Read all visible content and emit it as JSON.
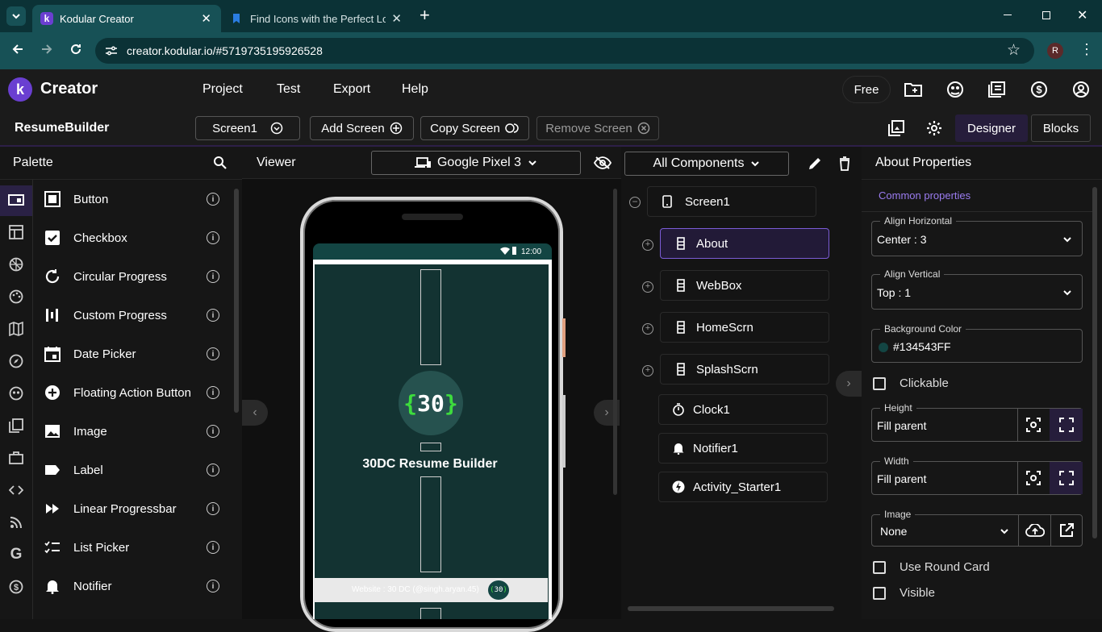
{
  "browser": {
    "tabs": [
      {
        "title": "Kodular Creator",
        "icon": "kodular-logo-icon"
      },
      {
        "title": "Find Icons with the Perfect Look",
        "icon": "bookmark-icon"
      }
    ],
    "url": "creator.kodular.io/#5719735195926528",
    "profile_initial": "R"
  },
  "app": {
    "logo_letter": "k",
    "name": "Creator",
    "menu": [
      "Project",
      "Test",
      "Export",
      "Help"
    ],
    "plan_badge": "Free"
  },
  "toolbar": {
    "project_name": "ResumeBuilder",
    "screen_select": "Screen1",
    "add_screen": "Add Screen",
    "copy_screen": "Copy Screen",
    "remove_screen": "Remove Screen",
    "designer": "Designer",
    "blocks": "Blocks"
  },
  "palette": {
    "title": "Palette",
    "items": [
      "Button",
      "Checkbox",
      "Circular Progress",
      "Custom Progress",
      "Date Picker",
      "Floating Action Button",
      "Image",
      "Label",
      "Linear Progressbar",
      "List Picker",
      "Notifier"
    ]
  },
  "viewer": {
    "title": "Viewer",
    "device": "Google Pixel 3",
    "status_time": "12:00",
    "logo_text": "30",
    "app_title": "30DC Resume Builder",
    "footer_text": "Website : 30 DC (@singh.aryan.45)",
    "footer_badge": "30"
  },
  "components": {
    "filter": "All Components",
    "root": "Screen1",
    "nodes": [
      "About",
      "WebBox",
      "HomeScrn",
      "SplashScrn",
      "Clock1",
      "Notifier1",
      "Activity_Starter1"
    ]
  },
  "properties": {
    "title": "About Properties",
    "section": "Common properties",
    "align_horizontal_label": "Align Horizontal",
    "align_horizontal": "Center : 3",
    "align_vertical_label": "Align Vertical",
    "align_vertical": "Top : 1",
    "background_color_label": "Background Color",
    "background_color": "#134543FF",
    "clickable": "Clickable",
    "height_label": "Height",
    "height": "Fill parent",
    "width_label": "Width",
    "width": "Fill parent",
    "image_label": "Image",
    "image": "None",
    "use_round_card": "Use Round Card",
    "visible": "Visible"
  },
  "colors": {
    "accent": "#6a3fd1",
    "screen_bg": "#134543",
    "logo_green": "#3ddc3d"
  }
}
